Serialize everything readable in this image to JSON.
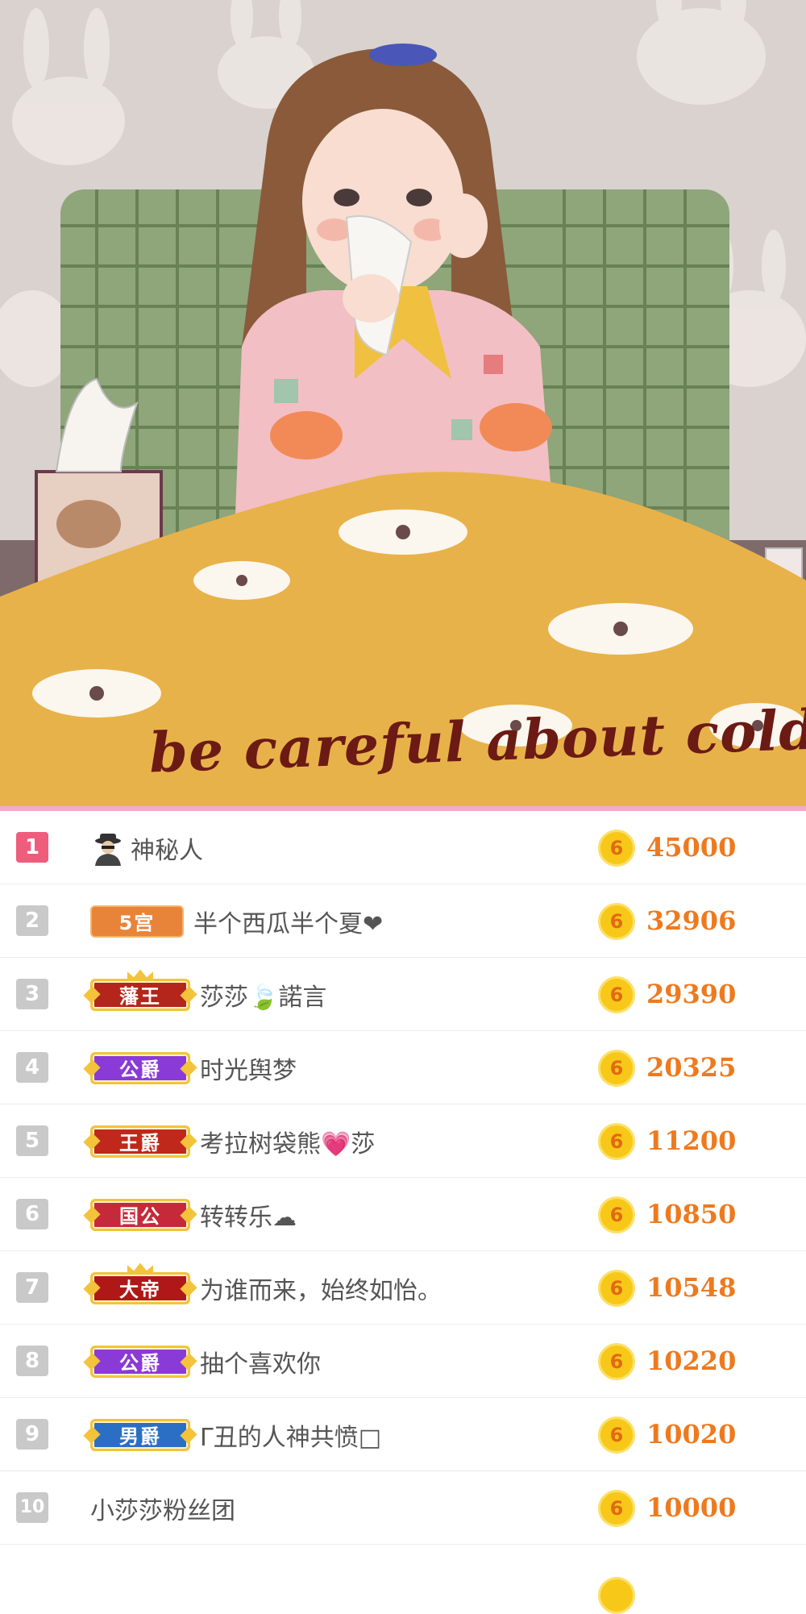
{
  "banner": {
    "caption": "be careful about cold",
    "alt": "illustration"
  },
  "ranking": {
    "coin_glyph": "6",
    "colors": {
      "accent_pink": "#f3a9c8",
      "top_rank": "#ee5d7c",
      "rank": "#c9c9c9",
      "score": "#ee7a1f",
      "coin": "#f7c818"
    },
    "rows": [
      {
        "rank": "1",
        "badge": "",
        "badge_type": "none",
        "badge_color": "",
        "name": "神秘人",
        "score": "45000",
        "spy_icon": true
      },
      {
        "rank": "2",
        "badge": "5宫",
        "badge_type": "level",
        "badge_color": "#e8843a",
        "name": "半个西瓜半个夏❤",
        "score": "32906"
      },
      {
        "rank": "3",
        "badge": "藩王",
        "badge_type": "title",
        "badge_color": "#b4251c",
        "name": "莎莎🍃諾言",
        "score": "29390",
        "crown": true
      },
      {
        "rank": "4",
        "badge": "公爵",
        "badge_type": "title",
        "badge_color": "#8a3ad6",
        "name": "时光舆梦",
        "score": "20325"
      },
      {
        "rank": "5",
        "badge": "王爵",
        "badge_type": "title",
        "badge_color": "#c0281c",
        "name": "考拉树袋熊💗莎",
        "score": "11200"
      },
      {
        "rank": "6",
        "badge": "国公",
        "badge_type": "title",
        "badge_color": "#c62a3a",
        "name": "转转乐☁",
        "score": "10850"
      },
      {
        "rank": "7",
        "badge": "大帝",
        "badge_type": "title",
        "badge_color": "#b01818",
        "name": "为谁而来，始终如怡。",
        "score": "10548",
        "crown": true
      },
      {
        "rank": "8",
        "badge": "公爵",
        "badge_type": "title",
        "badge_color": "#8a3ad6",
        "name": "抽个喜欢你",
        "score": "10220"
      },
      {
        "rank": "9",
        "badge": "男爵",
        "badge_type": "title",
        "badge_color": "#2b6fc4",
        "name": "Γ丑的人神共愤□",
        "score": "10020"
      },
      {
        "rank": "10",
        "badge": "",
        "badge_type": "none",
        "badge_color": "",
        "name": "小莎莎粉丝团",
        "score": "10000"
      }
    ]
  }
}
